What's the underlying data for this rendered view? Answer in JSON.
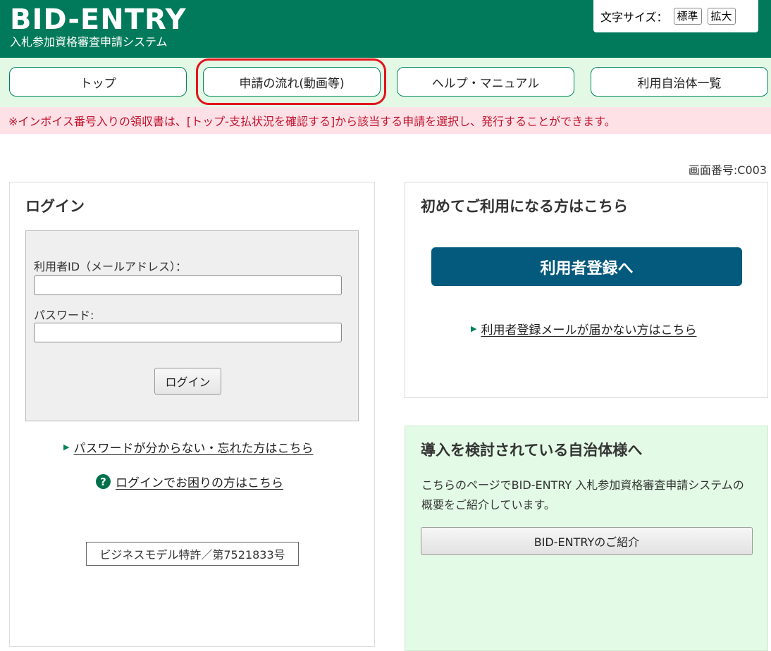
{
  "header": {
    "logo": "BID-ENTRY",
    "subtitle": "入札参加資格審査申請システム",
    "font_size_label": "文字サイズ：",
    "font_size_options": [
      "標準",
      "拡大"
    ]
  },
  "nav": {
    "items": [
      {
        "label": "トップ"
      },
      {
        "label": "申請の流れ(動画等)"
      },
      {
        "label": "ヘルプ・マニュアル"
      },
      {
        "label": "利用自治体一覧"
      }
    ],
    "highlighted_index": 1
  },
  "notice": "※インボイス番号入りの領収書は、[トップ-支払状況を確認する]から該当する申請を選択し、発行することができます。",
  "screen_number": "画面番号:C003",
  "login": {
    "title": "ログイン",
    "user_id_label": "利用者ID（メールアドレス）：",
    "user_id_value": "",
    "password_label": "パスワード:",
    "password_value": "",
    "login_button": "ログイン",
    "forgot_link": "パスワードが分からない・忘れた方はこちら",
    "trouble_link": "ログインでお困りの方はこちら",
    "patent": "ビジネスモデル特許／第7521833号"
  },
  "register": {
    "title": "初めてご利用になる方はこちら",
    "button": "利用者登録へ",
    "mail_link": "利用者登録メールが届かない方はこちら"
  },
  "municipality": {
    "title": "導入を検討されている自治体様へ",
    "description": "こちらのページでBID-ENTRY 入札参加資格審査申請システムの概要をご紹介しています。",
    "button": "BID-ENTRYのご紹介"
  },
  "colors": {
    "header_green": "#007a5a",
    "nav_bg": "#e3f9e5",
    "notice_bg": "#fde1e6",
    "notice_text": "#c1122c",
    "register_button": "#035a7d",
    "highlight_red": "#e3141b"
  }
}
